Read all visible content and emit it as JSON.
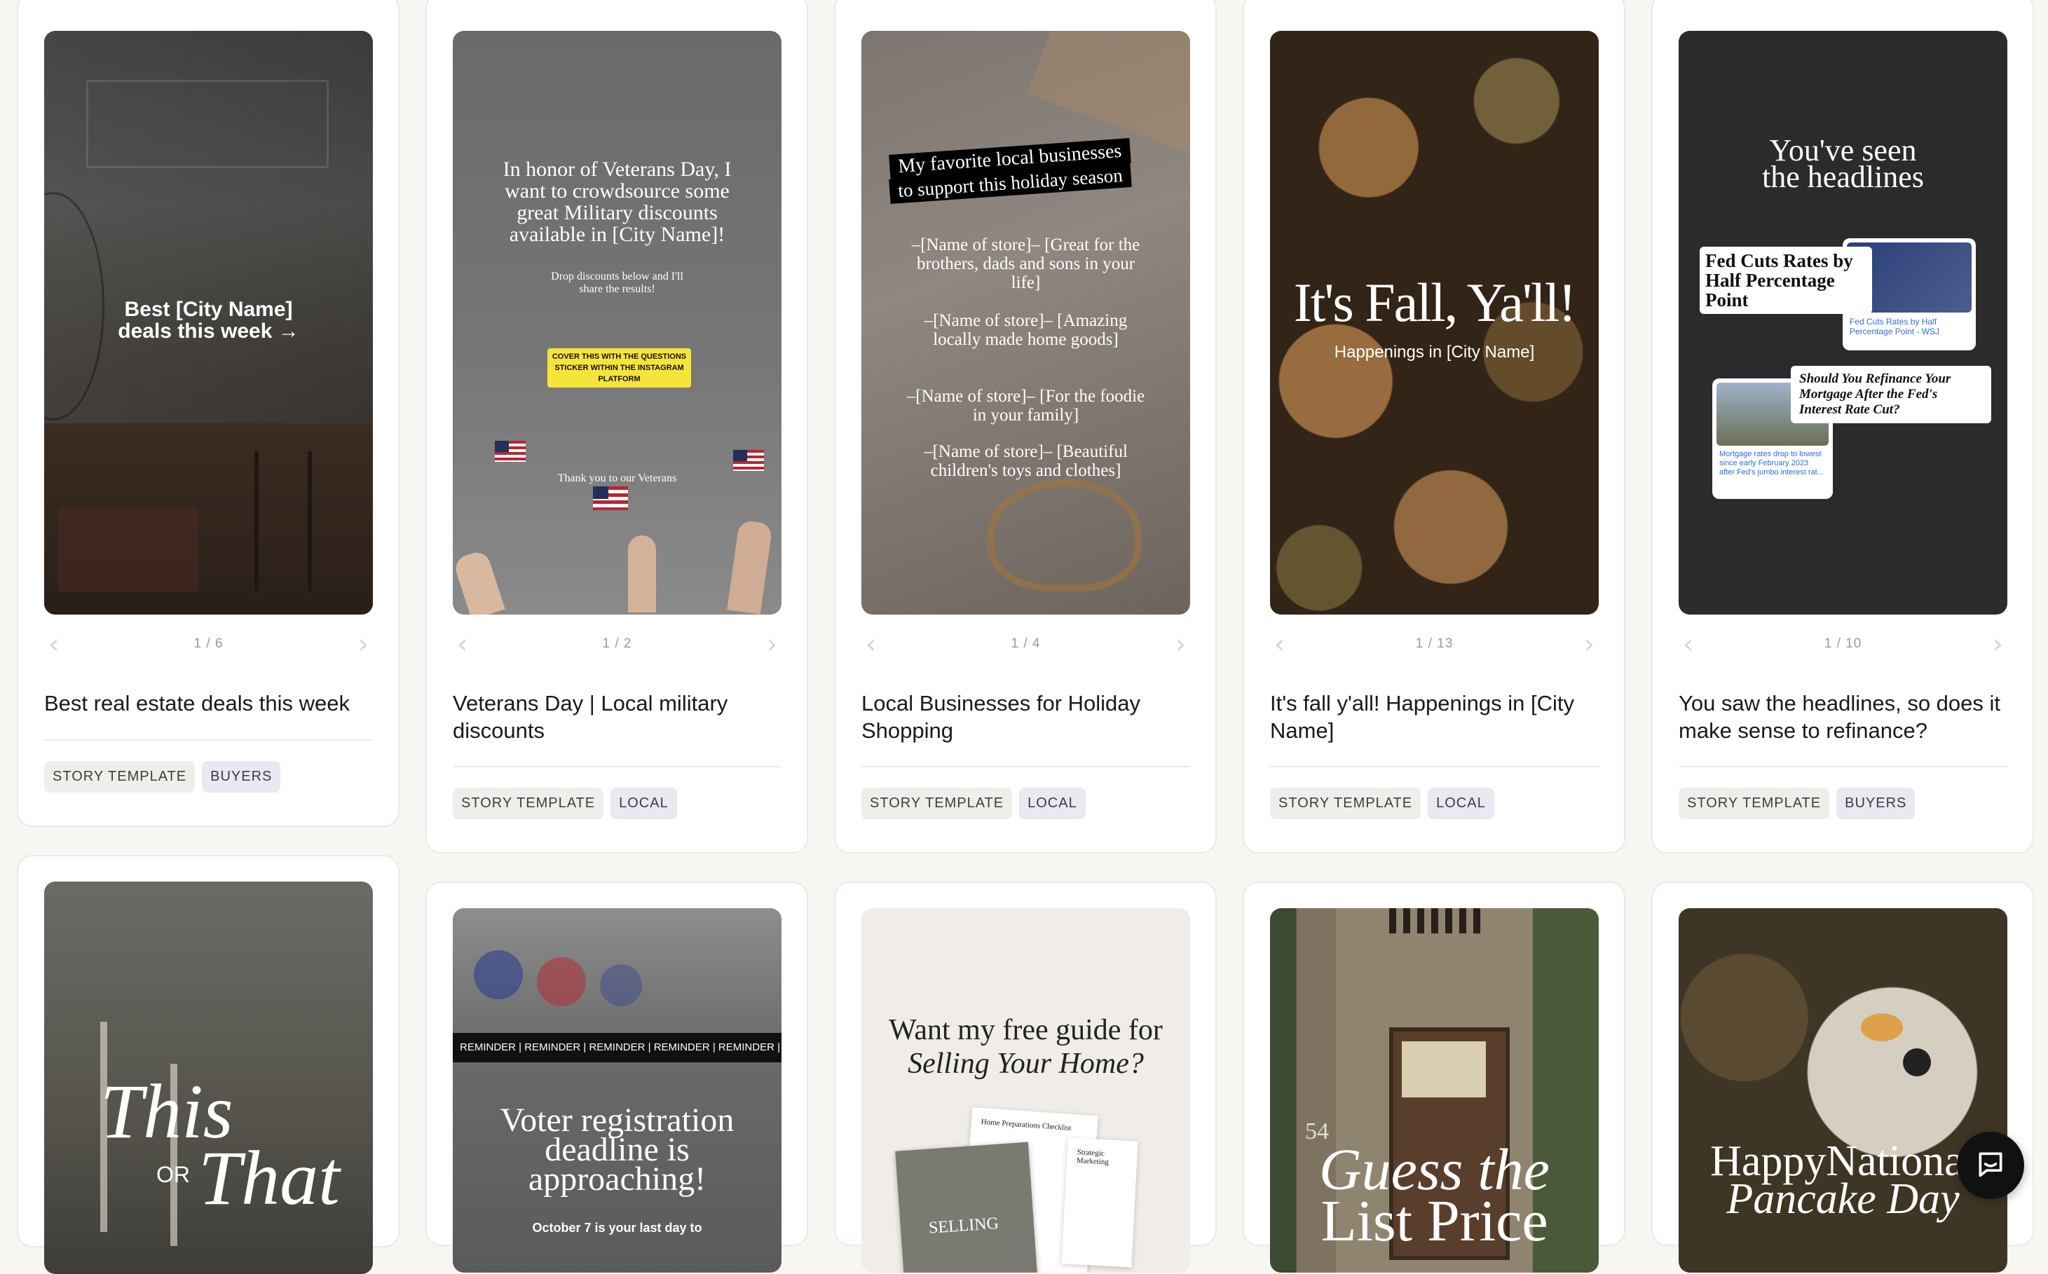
{
  "cards": [
    {
      "counter": "1 / 6",
      "title": "Best real estate deals this week",
      "tags": [
        "STORY TEMPLATE",
        "BUYERS"
      ],
      "thumb": {
        "headline": "Best [City Name] deals this week →"
      }
    },
    {
      "counter": "1 / 2",
      "title": "Veterans Day | Local military discounts",
      "tags": [
        "STORY TEMPLATE",
        "LOCAL"
      ],
      "thumb": {
        "headline": "In honor of Veterans Day, I want to crowdsource some great Military discounts available in [City Name]!",
        "sub": "Drop discounts below and I'll share the results!",
        "sticker": "COVER THIS WITH THE QUESTIONS STICKER WITHIN THE INSTAGRAM PLATFORM",
        "footer": "Thank you to our Veterans"
      }
    },
    {
      "counter": "1 / 4",
      "title": "Local Businesses for Holiday Shopping",
      "tags": [
        "STORY TEMPLATE",
        "LOCAL"
      ],
      "thumb": {
        "banner1": "My favorite local businesses",
        "banner2": "to support this holiday season",
        "items": [
          "–[Name of store]– [Great for the brothers, dads and sons in your life]",
          "–[Name of store]– [Amazing locally made home goods]",
          "–[Name of store]– [For the foodie in your family]",
          "–[Name of store]– [Beautiful children's toys and clothes]"
        ]
      }
    },
    {
      "counter": "1 / 13",
      "title": "It's fall y'all! Happenings in [City Name]",
      "tags": [
        "STORY TEMPLATE",
        "LOCAL"
      ],
      "thumb": {
        "headline": "It's Fall, Ya'll!",
        "sub": "Happenings in [City Name]"
      }
    },
    {
      "counter": "1 / 10",
      "title": "You saw the headlines, so does it make sense to refinance?",
      "tags": [
        "STORY TEMPLATE",
        "BUYERS"
      ],
      "thumb": {
        "headline1": "You've seen",
        "headline2": "the headlines",
        "news1": "Fed Cuts Rates by Half Percentage Point",
        "news1_caption": "Fed Cuts Rates by Half Percentage Point - WSJ",
        "news2": "Should You Refinance Your Mortgage After the Fed's Interest Rate Cut?",
        "news2_caption": "Mortgage rates drop to lowest since early February 2023 after Fed's jumbo interest rat..."
      }
    }
  ],
  "row2": [
    {
      "headline1": "This",
      "or": "OR",
      "headline2": "That"
    },
    {
      "ticker": "REMINDER | REMINDER | REMINDER | REMINDER | REMINDER |",
      "headline": "Voter registration deadline is approaching!",
      "sub": "October 7 is your last day to"
    },
    {
      "headline1": "Want my free guide for",
      "headline2": "Selling Your Home?",
      "doc1": "Home Preparations Checklist",
      "doc2": "Strategic Marketing",
      "cover": "SELLING"
    },
    {
      "headline1": "Guess the",
      "headline2": "List Price",
      "house_number": "54"
    },
    {
      "headline1": "HappyNational",
      "headline2": "Pancake Day"
    }
  ],
  "colors": {
    "accent": "#1b1b1b",
    "sticker": "#f7e43a",
    "tag_bg": "#efeeea"
  },
  "launcher": {
    "icon": "chat-icon"
  }
}
